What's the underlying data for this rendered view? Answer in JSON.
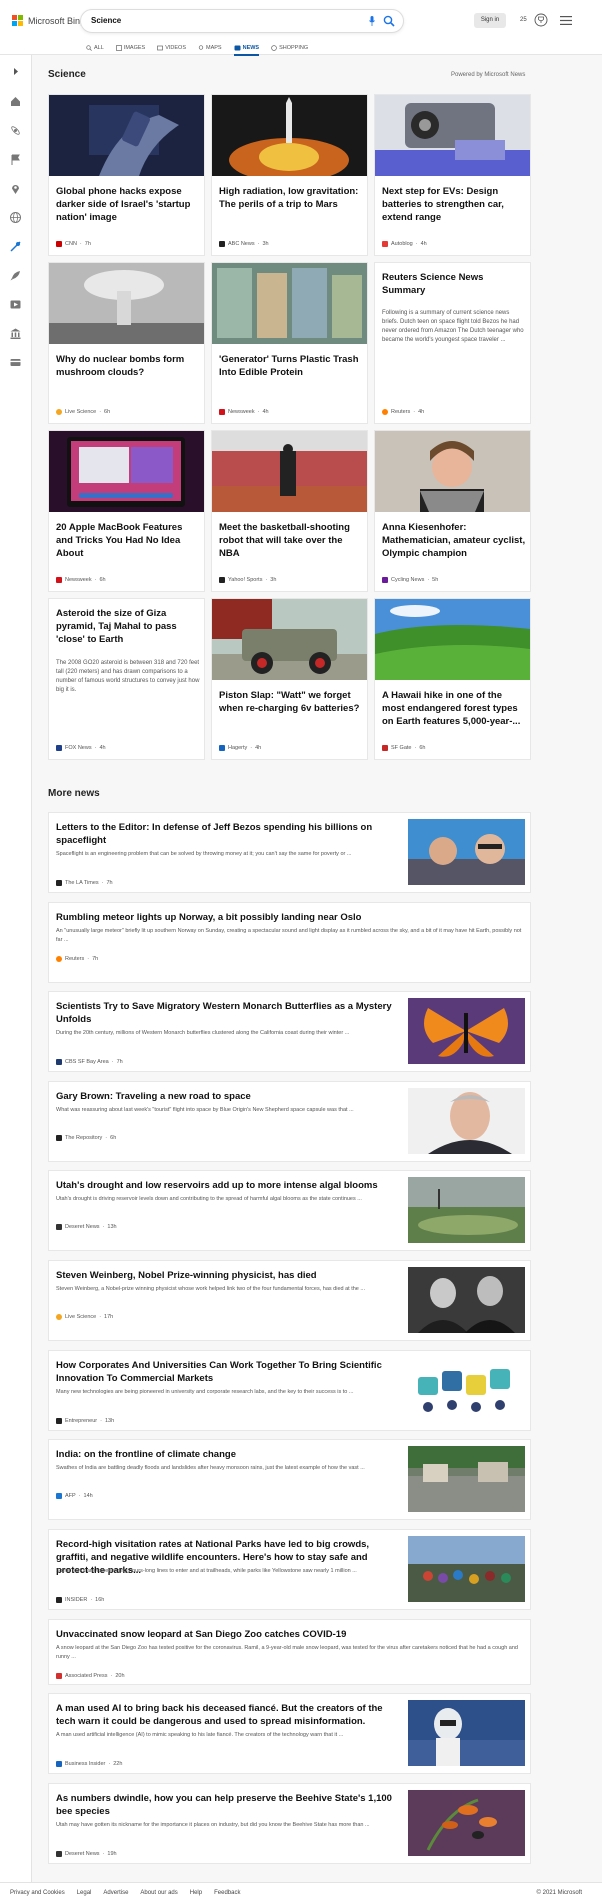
{
  "header": {
    "logo_text": "Microsoft Bing",
    "search_query": "Science",
    "tabs": [
      {
        "label": "ALL",
        "icon": "search-icon"
      },
      {
        "label": "IMAGES",
        "icon": "image-icon"
      },
      {
        "label": "VIDEOS",
        "icon": "video-icon"
      },
      {
        "label": "MAPS",
        "icon": "map-pin-icon"
      },
      {
        "label": "NEWS",
        "icon": "news-icon",
        "active": true
      },
      {
        "label": "SHOPPING",
        "icon": "tag-icon"
      }
    ],
    "signin_label": "Sign in",
    "rewards_count": "25"
  },
  "rail": {
    "icons": [
      "expand-icon",
      "home-icon",
      "science-icon",
      "flag-icon",
      "location-icon",
      "globe-icon",
      "health-icon",
      "rocket-icon",
      "video-icon",
      "government-icon",
      "card-icon"
    ]
  },
  "main": {
    "section_title": "Science",
    "powered_by": "Powered by Microsoft News",
    "cards": [
      {
        "title": "Global phone hacks expose darker side of Israel's 'startup nation' image",
        "source": "CNN",
        "age": "7h",
        "brand_color": "#cc0000"
      },
      {
        "title": "High radiation, low gravitation: The perils of a trip to Mars",
        "source": "ABC News",
        "age": "3h",
        "brand_color": "#222222"
      },
      {
        "title": "Next step for EVs: Design batteries to strengthen car, extend range",
        "source": "Autoblog",
        "age": "4h",
        "brand_color": "#e53935"
      },
      {
        "title": "Why do nuclear bombs form mushroom clouds?",
        "source": "Live Science",
        "age": "6h",
        "brand_color": "#f4a621"
      },
      {
        "title": "'Generator' Turns Plastic Trash Into Edible Protein",
        "source": "Newsweek",
        "age": "4h",
        "brand_color": "#d3111a"
      },
      {
        "title": "Reuters Science News Summary",
        "snippet": "Following is a summary of current science news briefs. Dutch teen on space flight told Bezos he had never ordered from Amazon The Dutch teenager who became the world's youngest space traveler ...",
        "source": "Reuters",
        "age": "4h",
        "brand_color": "#ff8000"
      },
      {
        "title": "20 Apple MacBook Features and Tricks You Had No Idea About",
        "source": "Newsweek",
        "age": "6h",
        "brand_color": "#d3111a"
      },
      {
        "title": "Meet the basketball-shooting robot that will take over the NBA",
        "source": "Yahoo! Sports",
        "age": "3h",
        "brand_color": "#222222"
      },
      {
        "title": "Anna Kiesenhofer: Mathematician, amateur cyclist, Olympic champion",
        "source": "Cycling News",
        "age": "5h",
        "brand_color": "#6a1b9a"
      },
      {
        "title": "Asteroid the size of Giza pyramid, Taj Mahal to pass 'close' to Earth",
        "snippet": "The 2008 GO20 asteroid is between 318 and 720 feet tall (220 meters) and has drawn comparisons to a number of famous world structures to convey just how big it is.",
        "source": "FOX News",
        "age": "4h",
        "brand_color": "#1f3f8a"
      },
      {
        "title": "Piston Slap: \"Watt\" we forget when re-charging 6v batteries?",
        "source": "Hagerty",
        "age": "4h",
        "brand_color": "#1565c0"
      },
      {
        "title": "A Hawaii hike in one of the most endangered forest types on Earth features 5,000-year-...",
        "source": "SF Gate",
        "age": "6h",
        "brand_color": "#c62828"
      }
    ],
    "more_title": "More news",
    "rows": [
      {
        "title": "Letters to the Editor: In defense of Jeff Bezos spending his billions on spaceflight",
        "snippet": "Spaceflight is an engineering problem that can be solved by throwing money at it; you can't say the same for poverty or ...",
        "source": "The LA Times",
        "age": "7h",
        "brand_color": "#222222"
      },
      {
        "title": "Rumbling meteor lights up Norway, a bit possibly landing near Oslo",
        "snippet": "An \"unusually large meteor\" briefly lit up southern Norway on Sunday, creating a spectacular sound and light display as it rumbled across the sky, and a bit of it may have hit Earth, possibly not far ...",
        "source": "Reuters",
        "age": "7h",
        "brand_color": "#ff8000"
      },
      {
        "title": "Scientists Try to Save Migratory Western Monarch Butterflies as a Mystery Unfolds",
        "snippet": "During the 20th century, millions of Western Monarch butterflies clustered along the California coast during their winter ...",
        "source": "CBS SF Bay Area",
        "age": "7h",
        "brand_color": "#1e3a6e"
      },
      {
        "title": "Gary Brown: Traveling a new road to space",
        "snippet": "What was reassuring about last week's \"tourist\" flight into space by Blue Origin's New Shepherd space capsule was that ...",
        "source": "The Repository",
        "age": "6h",
        "brand_color": "#222222"
      },
      {
        "title": "Utah's drought and low reservoirs add up to more intense algal blooms",
        "snippet": "Utah's drought is driving reservoir levels down and contributing to the spread of harmful algal blooms as the state continues ...",
        "source": "Deseret News",
        "age": "13h",
        "brand_color": "#333333"
      },
      {
        "title": "Steven Weinberg, Nobel Prize-winning physicist, has died",
        "snippet": "Steven Weinberg, a Nobel-prize winning physicist whose work helped link two of the four fundamental forces, has died at the ...",
        "source": "Live Science",
        "age": "17h",
        "brand_color": "#f4a621"
      },
      {
        "title": "How Corporates And Universities Can Work Together To Bring Scientific Innovation To Commercial Markets",
        "snippet": "Many new technologies are being pioneered in university and corporate research labs, and the key to their success is to ...",
        "source": "Entrepreneur",
        "age": "13h",
        "brand_color": "#222222"
      },
      {
        "title": "India: on the frontline of climate change",
        "snippet": "Swathes of India are battling deadly floods and landslides after heavy monsoon rains, just the latest example of how the vast ...",
        "source": "AFP",
        "age": "14h",
        "brand_color": "#1976d2"
      },
      {
        "title": "Record-high visitation rates at National Parks have led to big crowds, graffiti, and negative wildlife encounters. Here's how to stay safe and protect the parks...",
        "snippet": "Some parks are experiencing hours-long lines to enter and at trailheads, while parks like Yellowstone saw nearly 1 million ...",
        "source": "INSIDER",
        "age": "16h",
        "brand_color": "#222222"
      },
      {
        "title": "Unvaccinated snow leopard at San Diego Zoo catches COVID-19",
        "snippet": "A snow leopard at the San Diego Zoo has tested positive for the coronavirus. Ramil, a 9-year-old male snow leopard, was tested for the virus after caretakers noticed that he had a cough and runny ...",
        "source": "Associated Press",
        "age": "20h",
        "brand_color": "#d32f2f"
      },
      {
        "title": "A man used AI to bring back his deceased fiancé. But the creators of the tech warn it could be dangerous and used to spread misinformation.",
        "snippet": "A man used artificial intelligence (AI) to mimic speaking to his late fiancé. The creators of the technology warn that it ...",
        "source": "Business Insider",
        "age": "22h",
        "brand_color": "#1565c0"
      },
      {
        "title": "As numbers dwindle, how you can help preserve the Beehive State's 1,100 bee species",
        "snippet": "Utah may have gotten its nickname for the importance it places on industry, but did you know the Beehive State has more than ...",
        "source": "Deseret News",
        "age": "19h",
        "brand_color": "#333333"
      }
    ]
  },
  "footer": {
    "links": [
      "Privacy and Cookies",
      "Legal",
      "Advertise",
      "About our ads",
      "Help",
      "Feedback"
    ],
    "copyright": "© 2021 Microsoft"
  }
}
